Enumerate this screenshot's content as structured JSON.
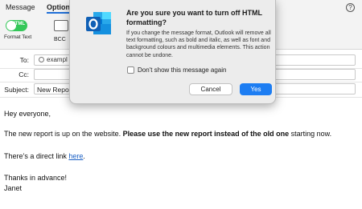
{
  "ribbon": {
    "tabs": [
      "Message",
      "Options"
    ],
    "html_toggle_label": "HTML",
    "format_text_label": "Format Text",
    "bcc_label": "BCC",
    "help_glyph": "?"
  },
  "header": {
    "to_label": "To:",
    "to_value": "exampl",
    "cc_label": "Cc:",
    "subject_label": "Subject:",
    "subject_value": "New Repor"
  },
  "body": {
    "greeting": "Hey everyone,",
    "p1_start": "The new report is up on the website. ",
    "p1_bold": "Please use the new report instead of the old one",
    "p1_end": " starting now.",
    "p2_start": "There’s a direct link ",
    "p2_link": "here",
    "p2_end": ".",
    "closing": "Thanks in advance!",
    "signature": "Janet"
  },
  "dialog": {
    "title": "Are you sure you want to turn off HTML formatting?",
    "message": "If you change the message format, Outlook will remove all text formatting, such as bold and italic, as well as font and background colours and multimedia elements. This action cannot be undone.",
    "checkbox_label": "Don't show this message again",
    "checkbox_checked": false,
    "cancel_label": "Cancel",
    "yes_label": "Yes",
    "icon": "outlook-app-icon"
  },
  "colors": {
    "accent": "#1d7df2",
    "toggle_on": "#34c759",
    "link": "#1a5fc4"
  }
}
